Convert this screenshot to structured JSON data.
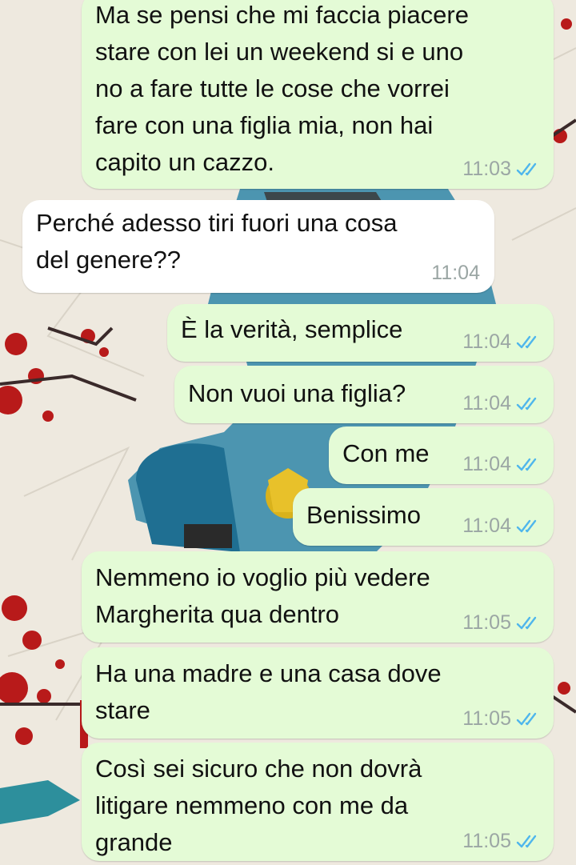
{
  "colors": {
    "outgoing_bubble": "#e4fbd6",
    "incoming_bubble": "#ffffff",
    "read_ticks": "#4fb6ec",
    "timestamp": "#9ba6a4"
  },
  "icons": {
    "read_receipt": "double-check-icon"
  },
  "messages": [
    {
      "direction": "outgoing",
      "text": "Ma se pensi che mi faccia piacere\nstare con lei un weekend si e uno\nno a fare tutte le cose che vorrei\nfare con una figlia mia, non hai\ncapito un cazzo.",
      "time": "11:03",
      "status": "read"
    },
    {
      "direction": "incoming",
      "text": "Perché adesso tiri fuori una cosa\ndel genere??",
      "time": "11:04"
    },
    {
      "direction": "outgoing",
      "text": "È la verità, semplice",
      "time": "11:04",
      "status": "read"
    },
    {
      "direction": "outgoing",
      "text": "Non vuoi una figlia?",
      "time": "11:04",
      "status": "read"
    },
    {
      "direction": "outgoing",
      "text": "Con me",
      "time": "11:04",
      "status": "read"
    },
    {
      "direction": "outgoing",
      "text": "Benissimo",
      "time": "11:04",
      "status": "read"
    },
    {
      "direction": "outgoing",
      "text": "Nemmeno io voglio più vedere\nMargherita qua dentro",
      "time": "11:05",
      "status": "read"
    },
    {
      "direction": "outgoing",
      "text": "Ha una madre e una casa dove\nstare",
      "time": "11:05",
      "status": "read"
    },
    {
      "direction": "outgoing",
      "text": "Così sei sicuro che non dovrà\nlitigare nemmeno con me da\ngrande",
      "time": "11:05",
      "status": "read"
    }
  ]
}
